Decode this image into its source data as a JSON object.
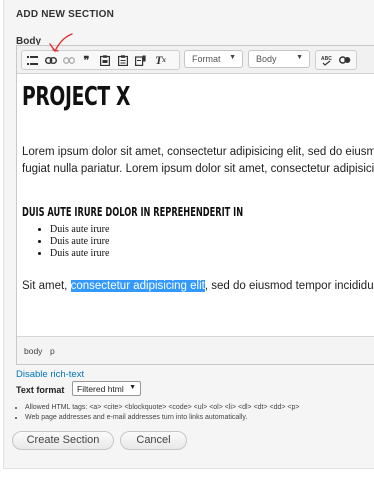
{
  "header": {
    "title": "ADD NEW SECTION"
  },
  "field": {
    "label": "Body"
  },
  "toolbar": {
    "format_label": "Format",
    "style_label": "Body"
  },
  "document": {
    "title": "PROJECT X",
    "paragraph1_line1": "Lorem ipsum dolor sit amet, consectetur adipisicing elit, sed do eiusm",
    "paragraph1_line2": "fugiat nulla pariatur. Lorem ipsum dolor sit amet, consectetur adipisicin",
    "heading": "DUIS AUTE IRURE DOLOR IN REPREHENDERIT IN",
    "bullets": [
      "Duis aute irure",
      "Duis aute irure",
      "Duis aute irure"
    ],
    "paragraph2_before": "Sit amet, ",
    "paragraph2_selected": "consectetur adipisicing elit",
    "paragraph2_after": ", sed do eiusmod tempor incididu"
  },
  "pathbar": {
    "items": [
      "body",
      "p"
    ]
  },
  "rich_text_toggle": "Disable rich-text",
  "text_format": {
    "label": "Text format",
    "selected": "Filtered html"
  },
  "tips": [
    "Allowed HTML tags: <a> <cite> <blockquote> <code> <ul> <ol> <li> <dl> <dt> <dd> <p>",
    "Web page addresses and e-mail addresses turn into links automatically."
  ],
  "actions": {
    "create_label": "Create Section",
    "cancel_label": "Cancel"
  },
  "colors": {
    "selection": "#3399ff",
    "link": "#0074bd",
    "annotation": "#e03030"
  },
  "icons": [
    "bulleted-list-icon",
    "link-icon",
    "unlink-icon",
    "blockquote-icon",
    "paste-icon",
    "paste-text-icon",
    "paste-word-icon",
    "remove-format-icon",
    "spellcheck-icon",
    "chain-icon"
  ]
}
